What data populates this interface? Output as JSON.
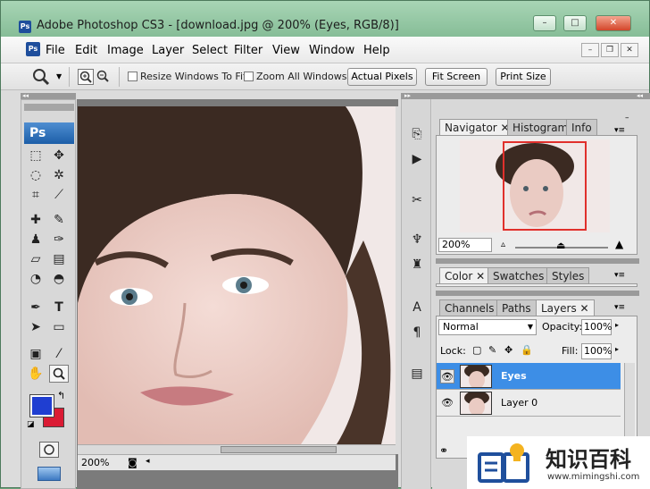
{
  "window": {
    "title": "Adobe Photoshop CS3 - [download.jpg @ 200% (Eyes, RGB/8)]",
    "app_icon": "Ps",
    "controls": {
      "minimize": "–",
      "maximize": "□",
      "close": "✕"
    }
  },
  "menubar": {
    "items": [
      "File",
      "Edit",
      "Image",
      "Layer",
      "Select",
      "Filter",
      "View",
      "Window",
      "Help"
    ],
    "doc_controls": {
      "minimize": "–",
      "restore": "❐",
      "close": "✕"
    }
  },
  "options": {
    "resize_windows_label": "Resize Windows To Fit",
    "zoom_all_label": "Zoom All Windows",
    "actual_pixels": "Actual Pixels",
    "fit_screen": "Fit Screen",
    "print_size": "Print Size"
  },
  "toolbox": {
    "logo": "Ps",
    "foreground_color": "#1f3ed1",
    "background_color": "#da1b34"
  },
  "document": {
    "zoom": "200%"
  },
  "navigator": {
    "tabs": [
      "Navigator",
      "Histogram",
      "Info"
    ],
    "zoom": "200%"
  },
  "color_panel": {
    "tabs": [
      "Color",
      "Swatches",
      "Styles"
    ]
  },
  "layers_panel": {
    "tabs": [
      "Channels",
      "Paths",
      "Layers"
    ],
    "blend_mode": "Normal",
    "opacity_label": "Opacity:",
    "opacity": "100%",
    "lock_label": "Lock:",
    "fill_label": "Fill:",
    "fill": "100%",
    "layers": [
      {
        "name": "Eyes",
        "selected": true
      },
      {
        "name": "Layer 0",
        "selected": false
      }
    ]
  },
  "watermark": {
    "title": "知识百科",
    "url": "www.mimingshi.com"
  }
}
